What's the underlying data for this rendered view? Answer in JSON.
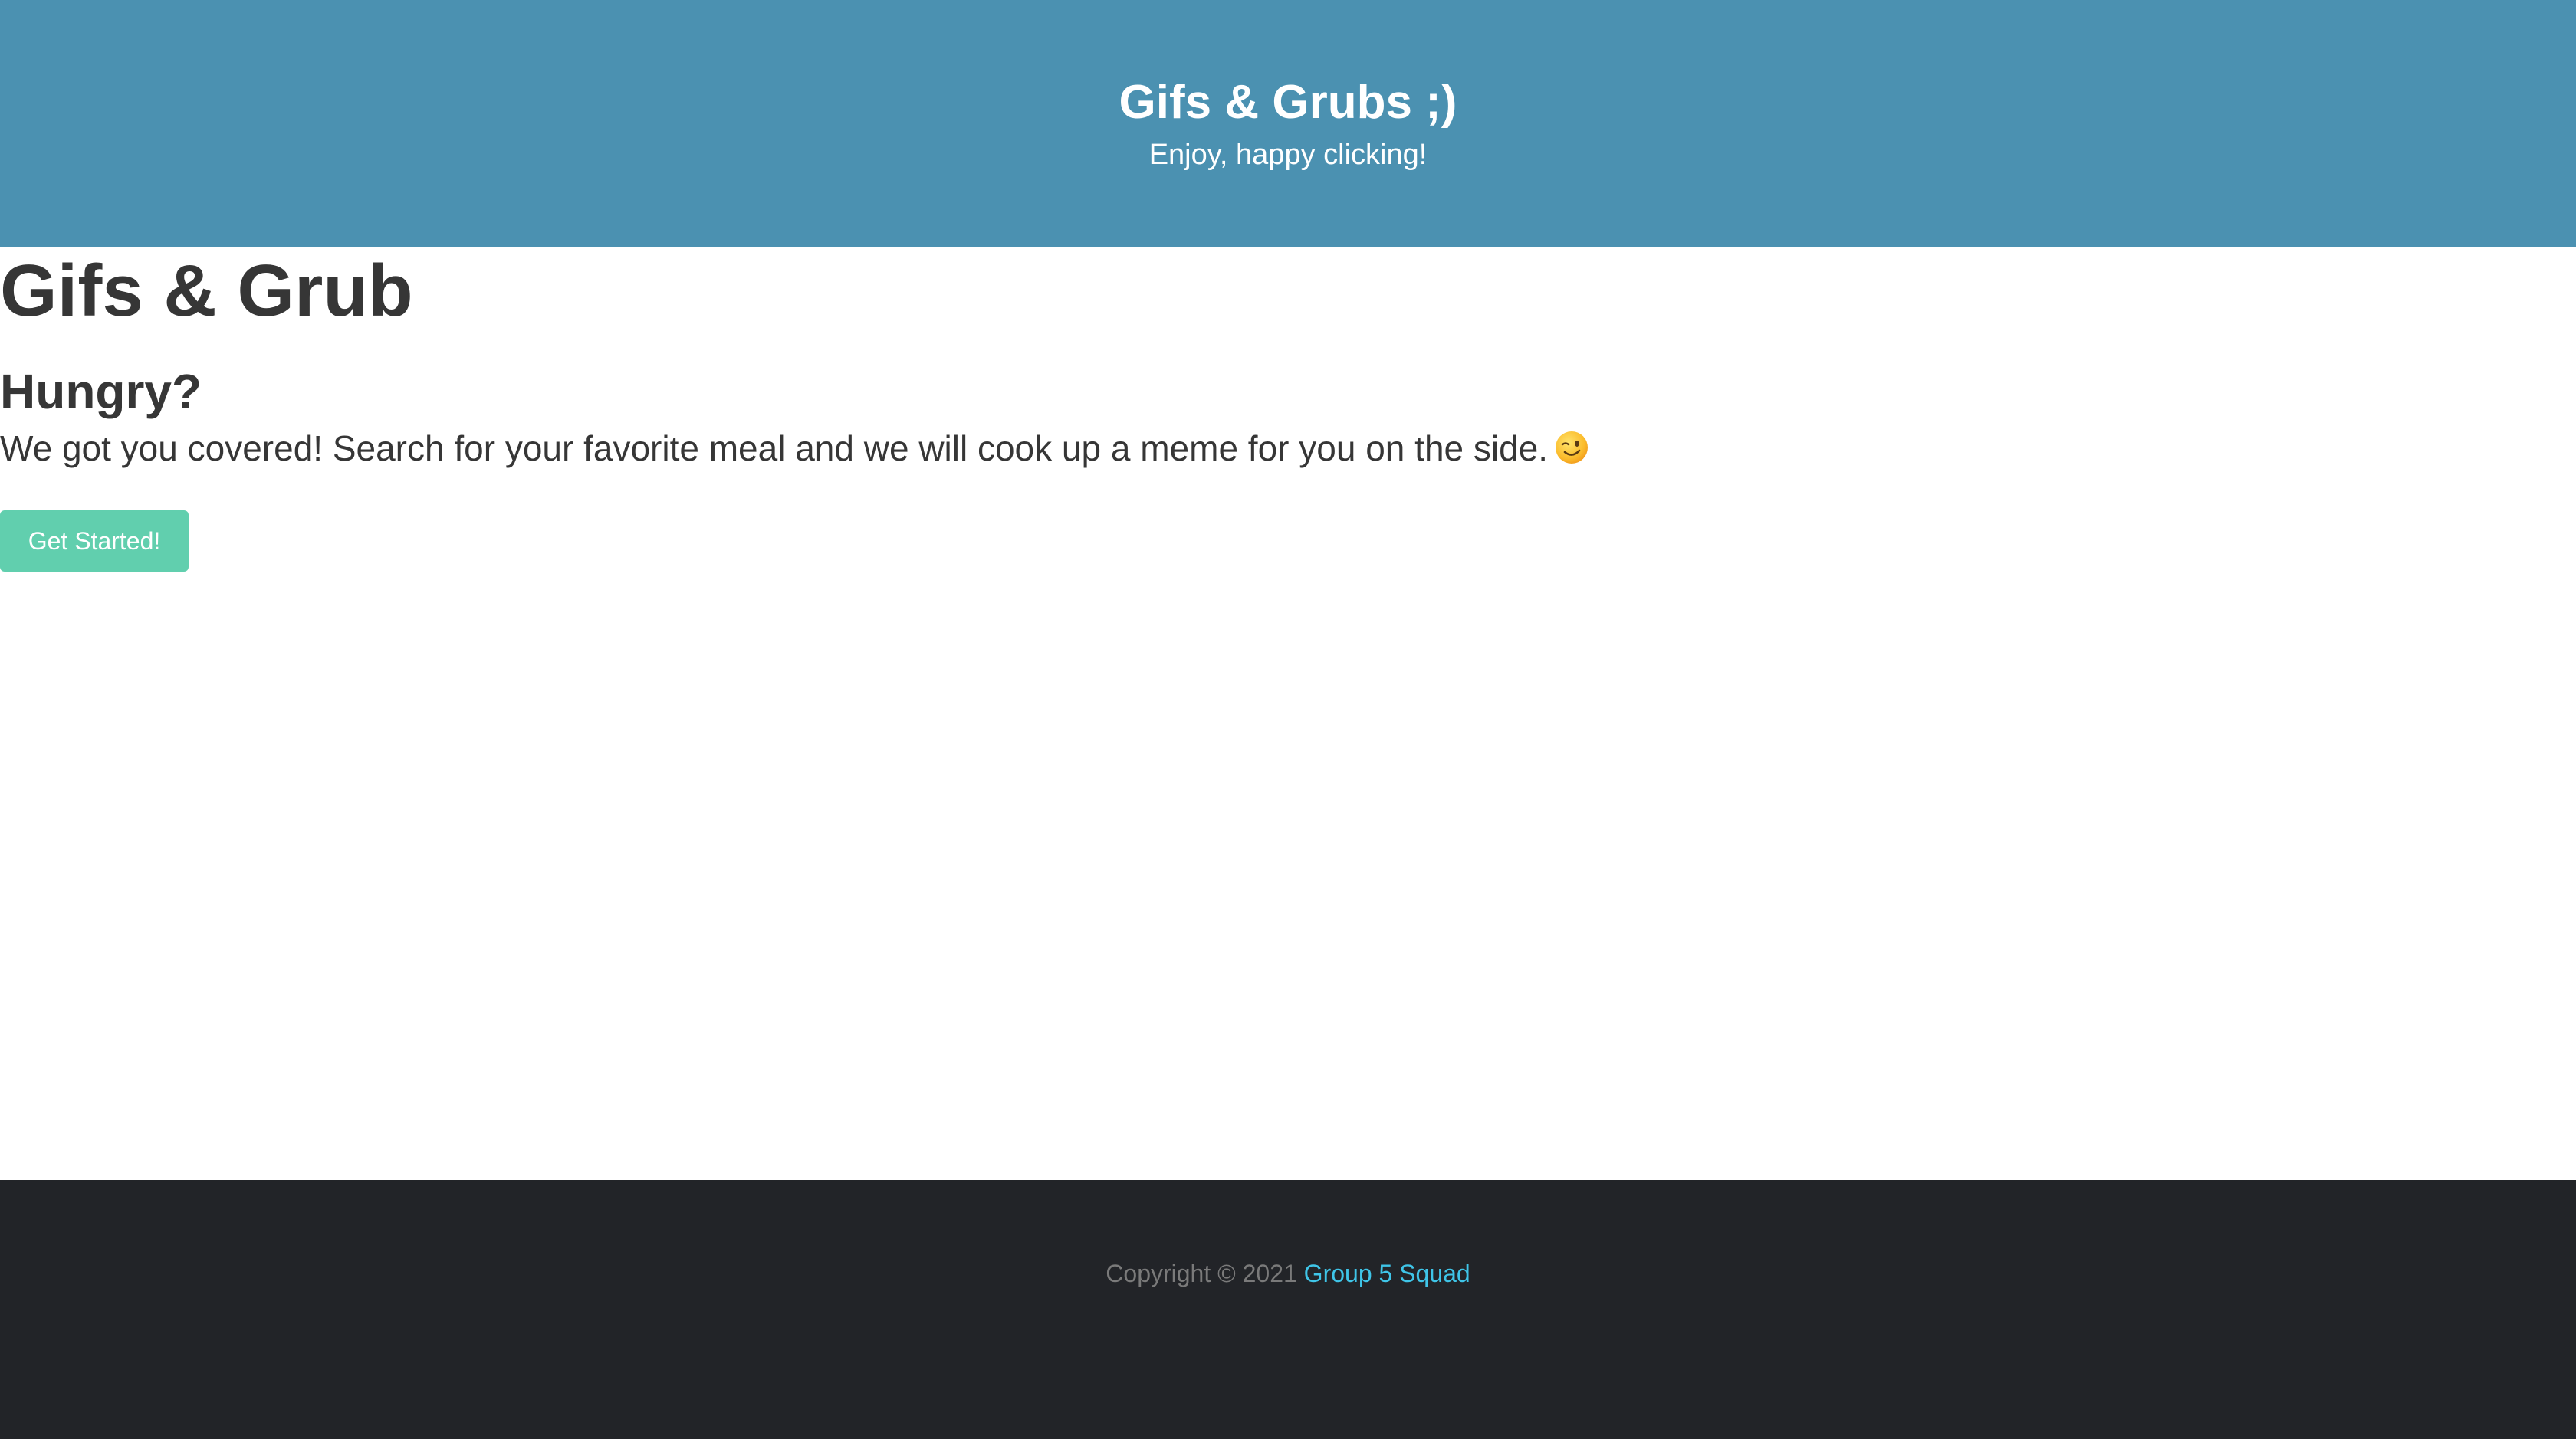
{
  "hero": {
    "title": "Gifs & Grubs ;)",
    "subtitle": "Enjoy, happy clicking!",
    "background_color": "#4b91b1"
  },
  "main": {
    "title": "Gifs & Grub",
    "subheading": "Hungry?",
    "description": "We got you covered! Search for your favorite meal and we will cook up a meme for you on the side.",
    "description_icon": "winking-face-emoji-icon",
    "cta_label": "Get Started!",
    "cta_color": "#61cfae"
  },
  "footer": {
    "copyright_text": "Copyright © 2021",
    "link_label": "Group 5 Squad",
    "background_color": "#222428",
    "link_color": "#3fc5e8"
  }
}
